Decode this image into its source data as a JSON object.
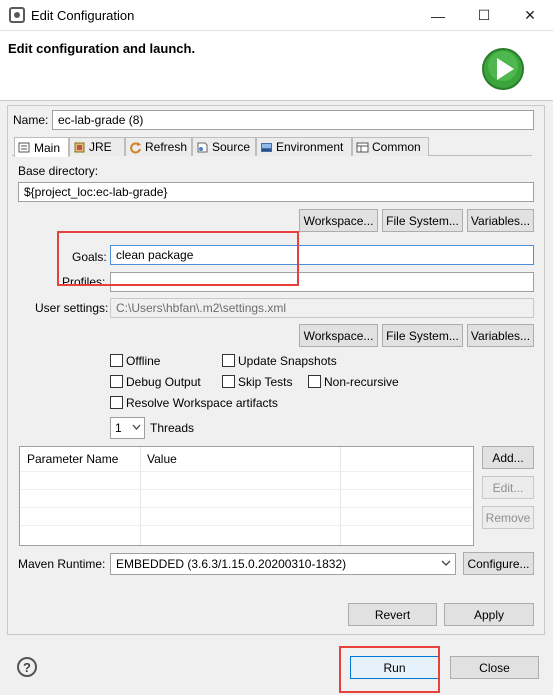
{
  "window": {
    "title": "Edit Configuration",
    "controls": {
      "minimize": "—",
      "maximize": "☐",
      "close": "✕"
    }
  },
  "header": {
    "title": "Edit configuration and launch."
  },
  "name": {
    "label": "Name:",
    "value": "ec-lab-grade (8)"
  },
  "tabs": [
    {
      "label": "Main",
      "icon": "maven-main-icon",
      "active": true
    },
    {
      "label": "JRE",
      "icon": "jre-icon"
    },
    {
      "label": "Refresh",
      "icon": "refresh-icon"
    },
    {
      "label": "Source",
      "icon": "source-icon"
    },
    {
      "label": "Environment",
      "icon": "environment-icon"
    },
    {
      "label": "Common",
      "icon": "common-icon"
    }
  ],
  "main": {
    "base_directory": {
      "label": "Base directory:",
      "value": "${project_loc:ec-lab-grade}"
    },
    "base_buttons": {
      "workspace": "Workspace...",
      "file_system": "File System...",
      "variables": "Variables..."
    },
    "goals": {
      "label": "Goals:",
      "value": "clean package"
    },
    "profiles": {
      "label": "Profiles:",
      "value": ""
    },
    "user_settings": {
      "label": "User settings:",
      "value": "C:\\Users\\hbfan\\.m2\\settings.xml"
    },
    "settings_buttons": {
      "workspace": "Workspace...",
      "file_system": "File System...",
      "variables": "Variables..."
    },
    "options": {
      "offline": "Offline",
      "update_snapshots": "Update Snapshots",
      "debug_output": "Debug Output",
      "skip_tests": "Skip Tests",
      "non_recursive": "Non-recursive",
      "resolve_workspace": "Resolve Workspace artifacts"
    },
    "threads": {
      "value": "1",
      "label": "Threads"
    },
    "parameters": {
      "columns": [
        "Parameter Name",
        "Value"
      ],
      "rows": [],
      "buttons": {
        "add": "Add...",
        "edit": "Edit...",
        "remove": "Remove"
      }
    },
    "maven_runtime": {
      "label": "Maven Runtime:",
      "value": "EMBEDDED (3.6.3/1.15.0.20200310-1832)",
      "configure": "Configure..."
    }
  },
  "panel_buttons": {
    "revert": "Revert",
    "apply": "Apply"
  },
  "footer": {
    "help": "?",
    "run": "Run",
    "close": "Close"
  },
  "colors": {
    "highlight_box": "#e8413c",
    "run_icon": "#3aa53a"
  }
}
